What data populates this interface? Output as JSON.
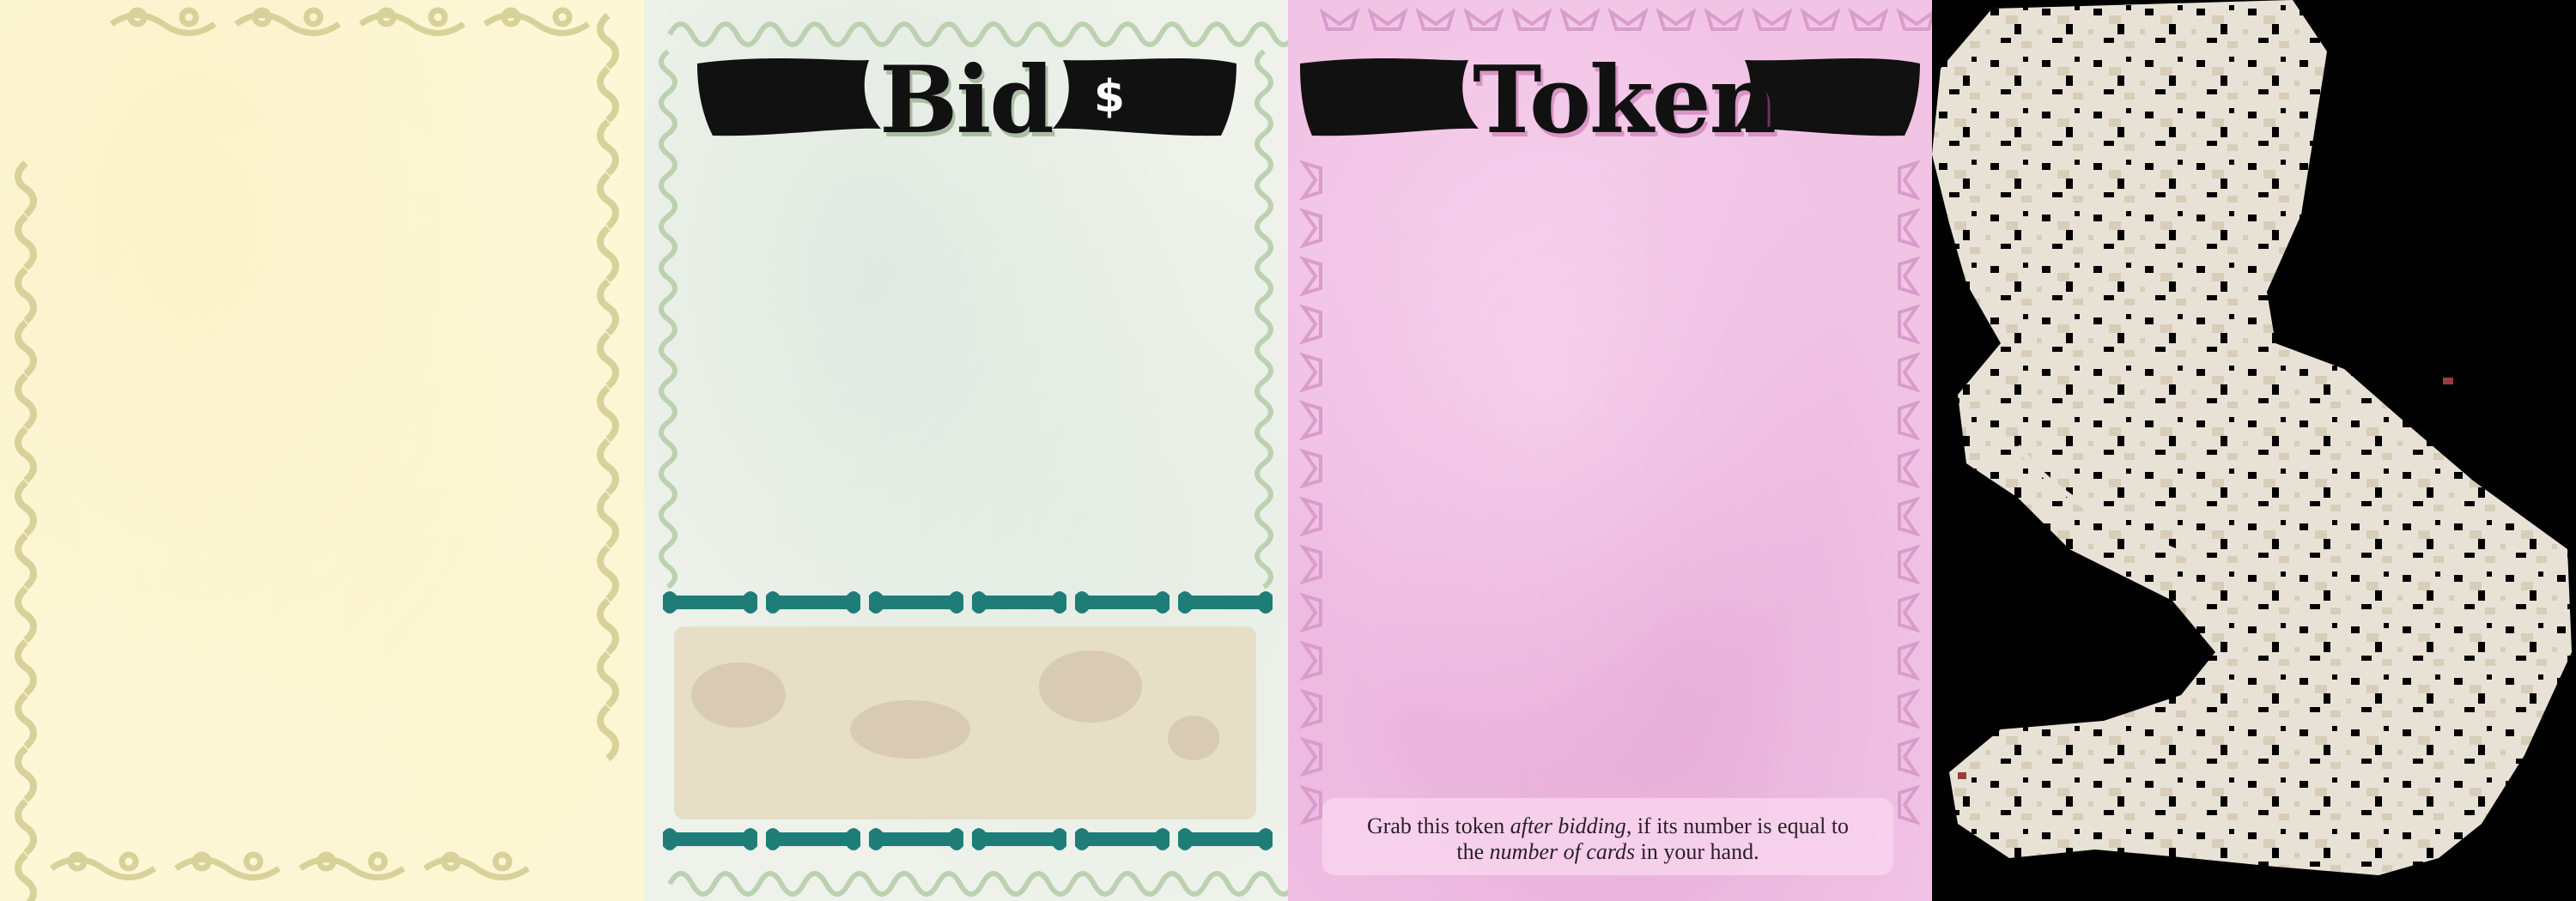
{
  "cards": {
    "bid": {
      "title": "Bid",
      "symbol": "$"
    },
    "token": {
      "title": "Token",
      "rules": {
        "part1": "Grab this token ",
        "em1": "after bidding",
        "part2": ", if its number is equal to",
        "part3": "the ",
        "em2": "number of cards",
        "part4": " in your hand."
      }
    }
  },
  "colors": {
    "cream": "#fdf7d6",
    "cream_ornament": "#d8d19a",
    "bid_bg": "#eef2ea",
    "bid_ornament": "#bcd1b0",
    "bid_teal": "#1f7d78",
    "token_bg": "#f1c4e6",
    "token_ornament": "#d99ccb",
    "banner": "#111111",
    "label_tan": "#e6dec7"
  }
}
